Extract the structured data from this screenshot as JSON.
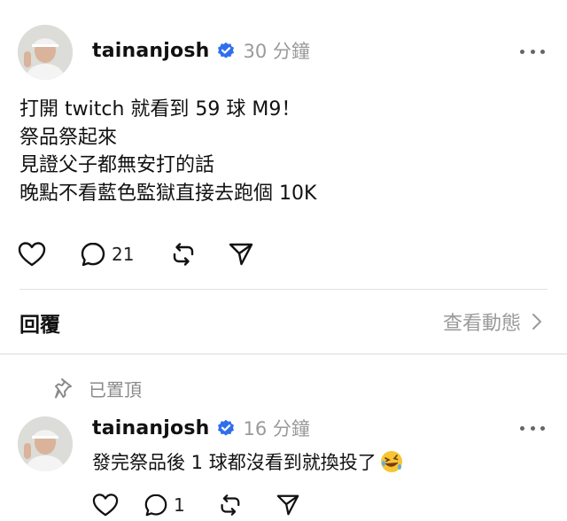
{
  "post": {
    "username": "tainanjosh",
    "timestamp": "30 分鐘",
    "lines": [
      "打開 twitch 就看到 59 球 M9！",
      "祭品祭起來",
      "見證父子都無安打的話",
      "晚點不看藍色監獄直接去跑個 10K"
    ],
    "comment_count": "21"
  },
  "replies_section": {
    "title": "回覆",
    "activity_label": "查看動態"
  },
  "reply": {
    "pinned_label": "已置頂",
    "username": "tainanjosh",
    "timestamp": "16 分鐘",
    "text": "發完祭品後 1 球都沒看到就換投了",
    "emoji": "rolling-on-floor-laughing",
    "comment_count": "1"
  },
  "colors": {
    "verified_badge": "#2f6fed",
    "secondary_text": "#9a9a9a"
  },
  "icons": [
    "verified-badge-icon",
    "more-icon",
    "heart-icon",
    "comment-icon",
    "repost-icon",
    "share-icon",
    "chevron-right-icon",
    "pin-icon"
  ]
}
